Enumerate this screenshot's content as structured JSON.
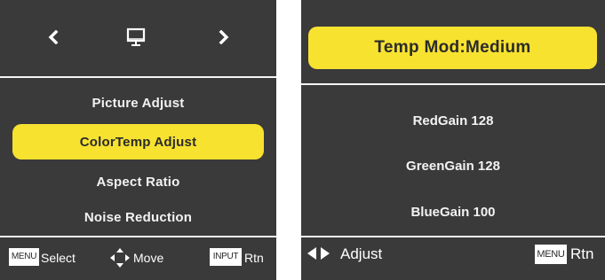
{
  "left_panel": {
    "top_nav": {
      "prev_icon": "chevron-left-icon",
      "category_icon": "monitor-icon",
      "next_icon": "chevron-right-icon"
    },
    "menu_items": [
      {
        "label": "Picture Adjust",
        "selected": false
      },
      {
        "label": "ColorTemp Adjust",
        "selected": true
      },
      {
        "label": "Aspect Ratio",
        "selected": false
      },
      {
        "label": "Noise Reduction",
        "selected": false
      }
    ],
    "footer": {
      "menu_key": "MENU",
      "select_label": "Select",
      "move_icon": "four-way-arrow-icon",
      "move_label": "Move",
      "input_key": "INPUT",
      "return_label": "Rtn"
    }
  },
  "right_panel": {
    "title": "Temp Mod:Medium",
    "gains": [
      {
        "label": "RedGain 128"
      },
      {
        "label": "GreenGain 128"
      },
      {
        "label": "BlueGain 100"
      }
    ],
    "footer": {
      "adjust_icon": "left-right-arrows-icon",
      "adjust_label": "Adjust",
      "menu_key": "MENU",
      "return_label": "Rtn"
    }
  },
  "colors": {
    "panel_background": "#3a3a3a",
    "highlight": "#f7e230",
    "text": "#ffffff",
    "divider": "#f4f4f4"
  }
}
